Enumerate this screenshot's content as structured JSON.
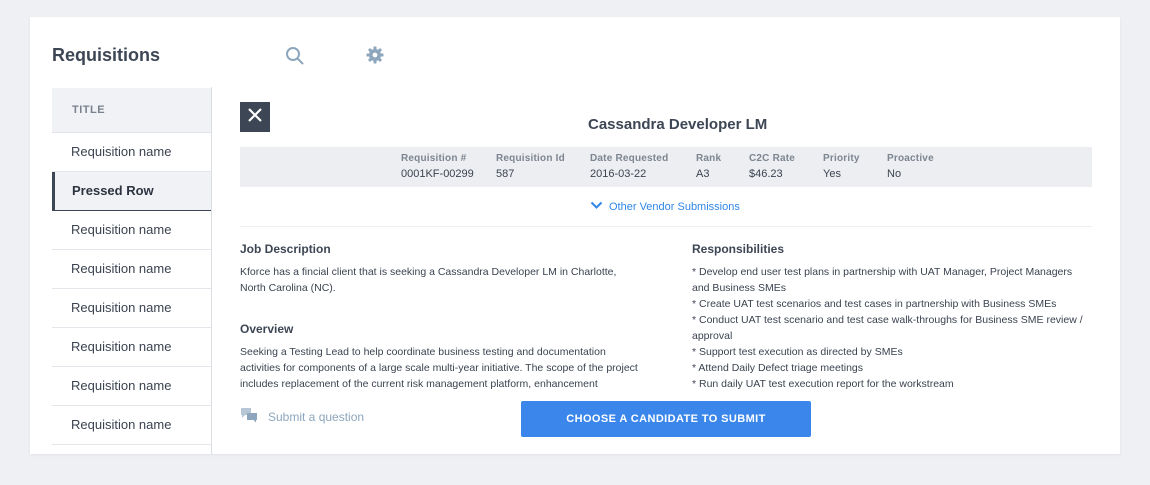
{
  "header": {
    "title": "Requisitions",
    "search_icon": "search-icon",
    "settings_icon": "gear-icon"
  },
  "sidebar": {
    "column_header": "TITLE",
    "rows": [
      {
        "label": "Requisition name"
      },
      {
        "label": "Pressed Row",
        "pressed": true
      },
      {
        "label": "Requisition name"
      },
      {
        "label": "Requisition name"
      },
      {
        "label": "Requisition name"
      },
      {
        "label": "Requisition name"
      },
      {
        "label": "Requisition name"
      },
      {
        "label": "Requisition name"
      }
    ]
  },
  "detail": {
    "close_icon": "close-icon",
    "title": "Cassandra Developer LM",
    "meta": [
      {
        "label": "Requisition #",
        "value": "0001KF-00299"
      },
      {
        "label": "Requisition Id",
        "value": "587"
      },
      {
        "label": "Date Requested",
        "value": "2016-03-22"
      },
      {
        "label": "Rank",
        "value": "A3"
      },
      {
        "label": "C2C Rate",
        "value": "$46.23"
      },
      {
        "label": "Priority",
        "value": "Yes"
      },
      {
        "label": "Proactive",
        "value": "No"
      }
    ],
    "vendor_link": "Other Vendor Submissions",
    "job_description_heading": "Job Description",
    "job_description_text": "Kforce has a fincial client that is seeking a Cassandra Developer LM in Charlotte, North Carolina (NC).",
    "overview_heading": "Overview",
    "overview_text": "Seeking a Testing Lead to help coordinate business testing and documentation activities for components of a large scale multi-year initiative. The scope of the project includes replacement of the current risk management platform, enhancement",
    "responsibilities_heading": "Responsibilities",
    "responsibilities": [
      "* Develop end user test plans in partnership with UAT Manager, Project Managers and Business SMEs",
      "* Create UAT test scenarios and test cases in partnership with Business SMEs",
      "* Conduct UAT test scenario and test case walk-throughs for Business SME review / approval",
      "* Support test execution as directed by SMEs",
      "* Attend Daily Defect triage meetings",
      "* Run daily UAT test execution report for the workstream"
    ]
  },
  "footer": {
    "submit_question": "Submit a question",
    "cta": "CHOOSE A CANDIDATE TO SUBMIT"
  },
  "colors": {
    "accent": "#3a86ea",
    "dark": "#3d4654",
    "link": "#2f86e8"
  }
}
